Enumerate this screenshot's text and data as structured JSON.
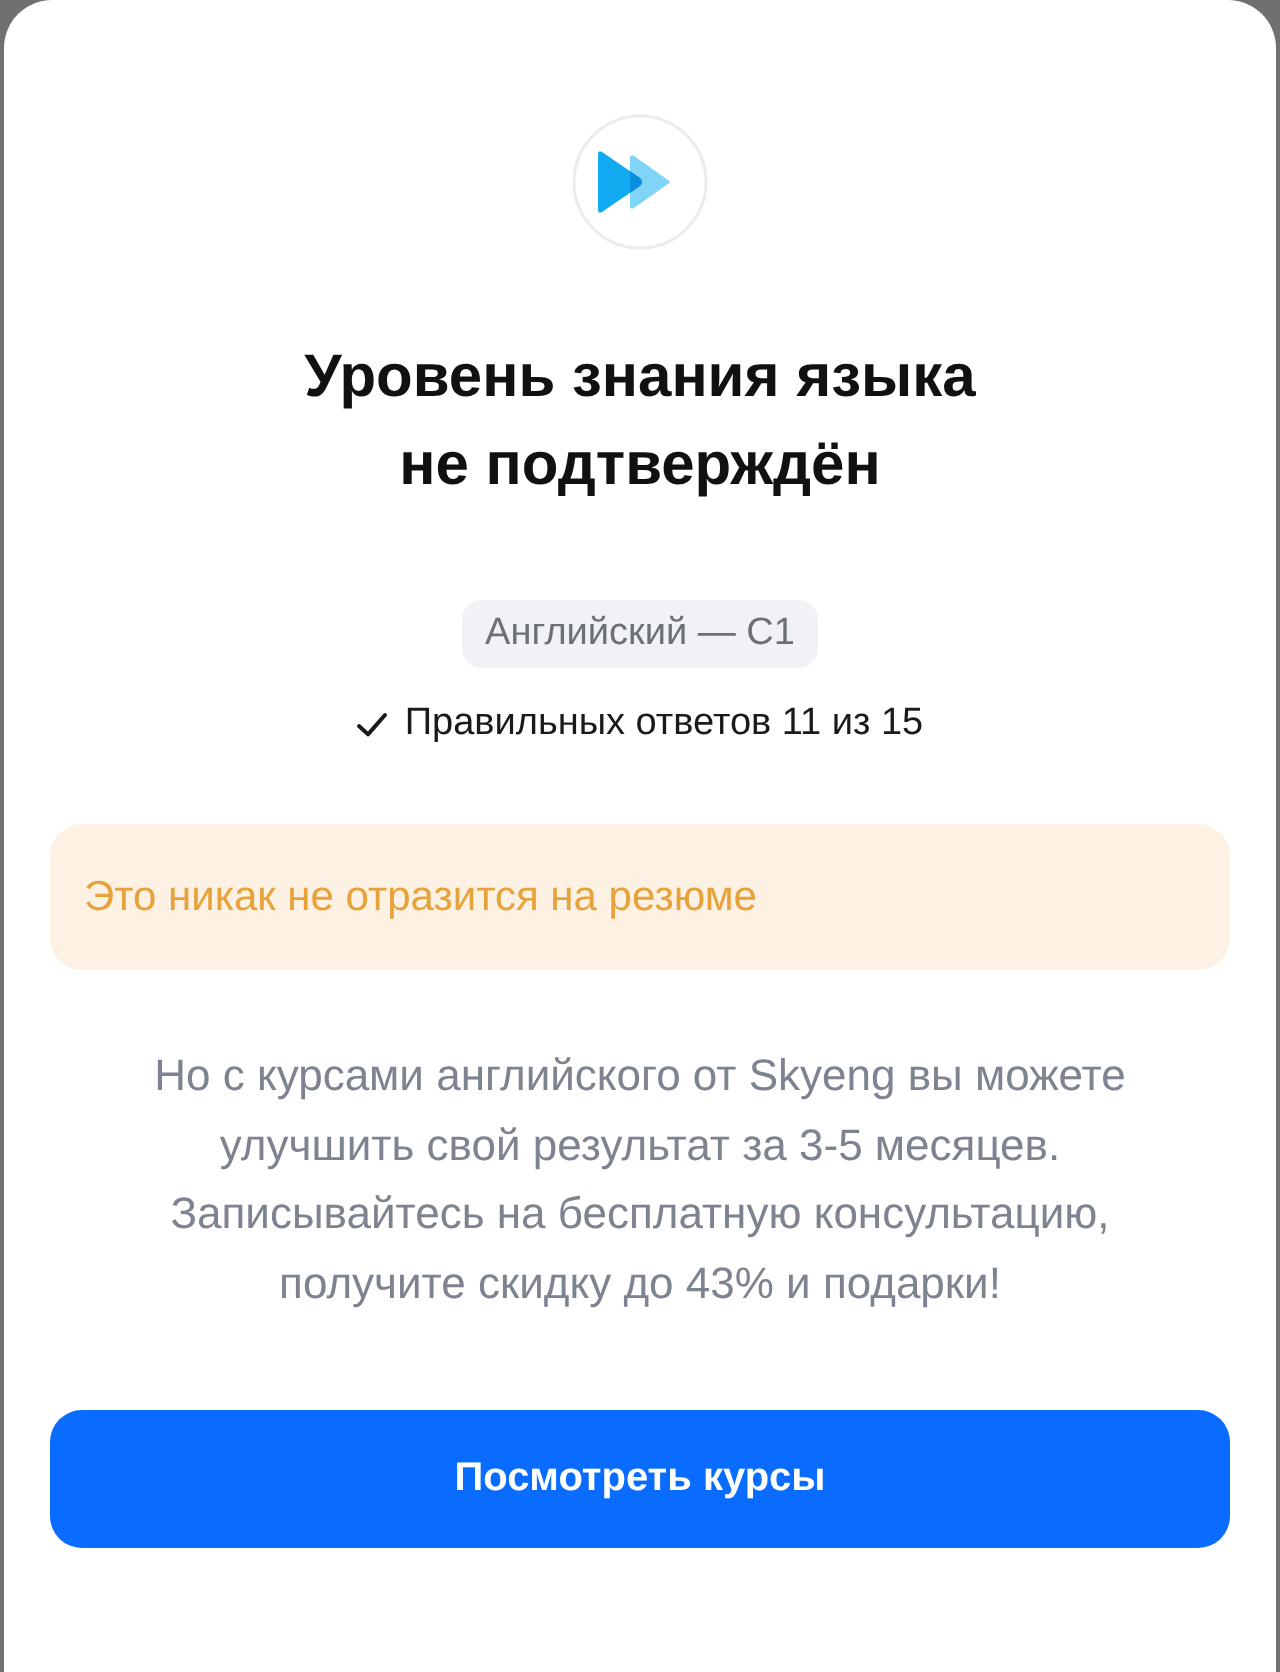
{
  "title": "Уровень знания языка не подтверждён",
  "level_chip": "Английский — C1",
  "result": "Правильных ответов 11 из 15",
  "notice": "Это никак не отразится на резюме",
  "description": "Но с курсами английского от Skyeng вы можете улучшить свой результат за 3-5 месяцев. Записывайтесь на бесплатную консультацию, получите скидку до 43% и подарки!",
  "button": "Посмотреть курсы"
}
